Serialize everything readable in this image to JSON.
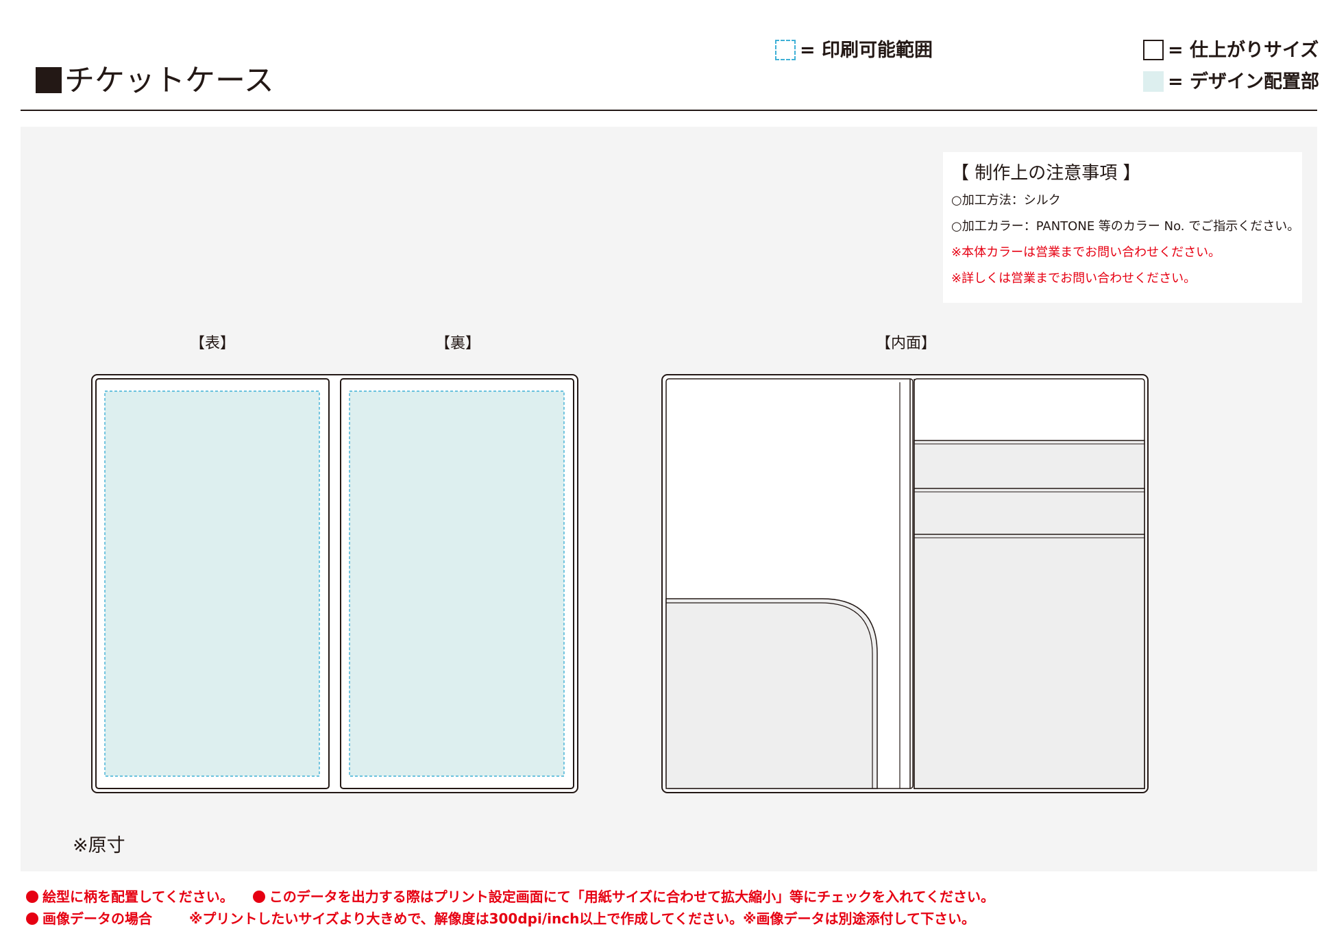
{
  "header": {
    "title": "チケットケース",
    "legend_print_area": "= 印刷可能範囲",
    "legend_finish_size": "= 仕上がりサイズ",
    "legend_design_area": "= デザイン配置部"
  },
  "notes": {
    "title": "【 制作上の注意事項 】",
    "method": "○加工方法：シルク",
    "color": "○加工カラー：PANTONE 等のカラー No. でご指示ください。",
    "warning_body_color": "※本体カラーは営業までお問い合わせください。",
    "warning_details": "※詳しくは営業までお問い合わせください。"
  },
  "panels": {
    "front_label": "【表】",
    "back_label": "【裏】",
    "inner_label": "【内面】"
  },
  "scale_note": "※原寸",
  "footer": {
    "line1_a": "絵型に柄を配置してください。",
    "line1_b": "このデータを出力する際はプリント設定画面にて「用紙サイズに合わせて拡大縮小」等にチェックを入れてください。",
    "line2_a": "画像データの場合",
    "line2_b": "※プリントしたいサイズより大きめで、解像度は300dpi/inch以上で作成してください。※画像データは別途添付して下さい。"
  },
  "colors": {
    "accent_red": "#e60012",
    "print_area_dash": "#3fb0d6",
    "design_area_fill": "#ddefef",
    "work_background": "#f4f4f4"
  }
}
